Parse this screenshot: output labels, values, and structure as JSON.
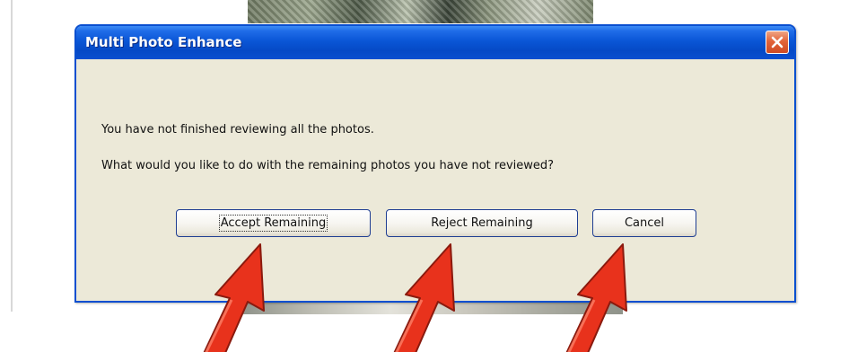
{
  "dialog": {
    "title": "Multi Photo Enhance",
    "message_line1": "You have not finished reviewing all the photos.",
    "message_line2": "What would you like to do with the remaining photos you have not reviewed?",
    "buttons": {
      "accept": "Accept Remaining",
      "reject": "Reject Remaining",
      "cancel": "Cancel"
    }
  },
  "colors": {
    "title_bar": "#0a56d6",
    "dialog_body": "#ece9d8",
    "close_button": "#e2643a",
    "arrow": "#e8321c"
  },
  "icons": {
    "close": "close-icon",
    "annotation_arrow": "red-arrow-icon"
  }
}
